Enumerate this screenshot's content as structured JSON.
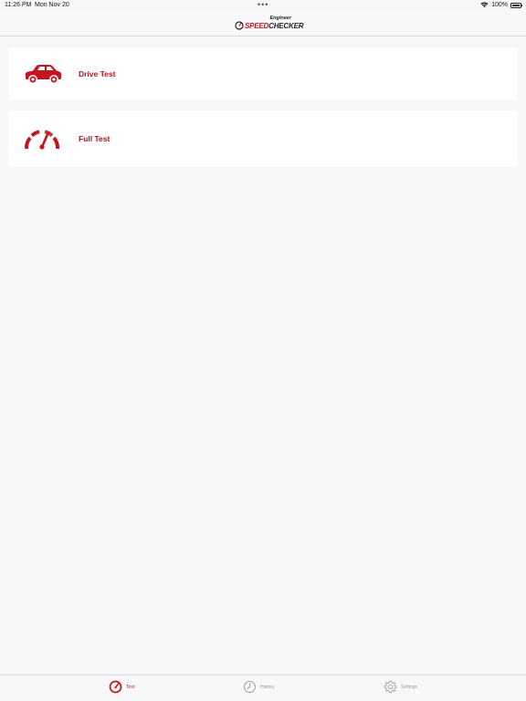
{
  "status_bar": {
    "time": "11:26 PM",
    "date": "Mon Nov 20",
    "dots": "•••",
    "battery": "100%"
  },
  "header": {
    "logo_sub": "Engineer",
    "logo_speed": "SPEED",
    "logo_checker": "CHECKER"
  },
  "cards": {
    "drive_test": {
      "label": "Drive Test",
      "icon": "car-icon"
    },
    "full_test": {
      "label": "Full Test",
      "icon": "speedometer-icon"
    }
  },
  "tabs": {
    "test": {
      "label": "Test",
      "icon": "speedometer-icon"
    },
    "history": {
      "label": "History",
      "icon": "clock-icon"
    },
    "settings": {
      "label": "Settings",
      "icon": "gear-icon"
    }
  },
  "colors": {
    "accent": "#c4141d",
    "inactive": "#9a9a9e",
    "background": "#f6f7f9"
  }
}
